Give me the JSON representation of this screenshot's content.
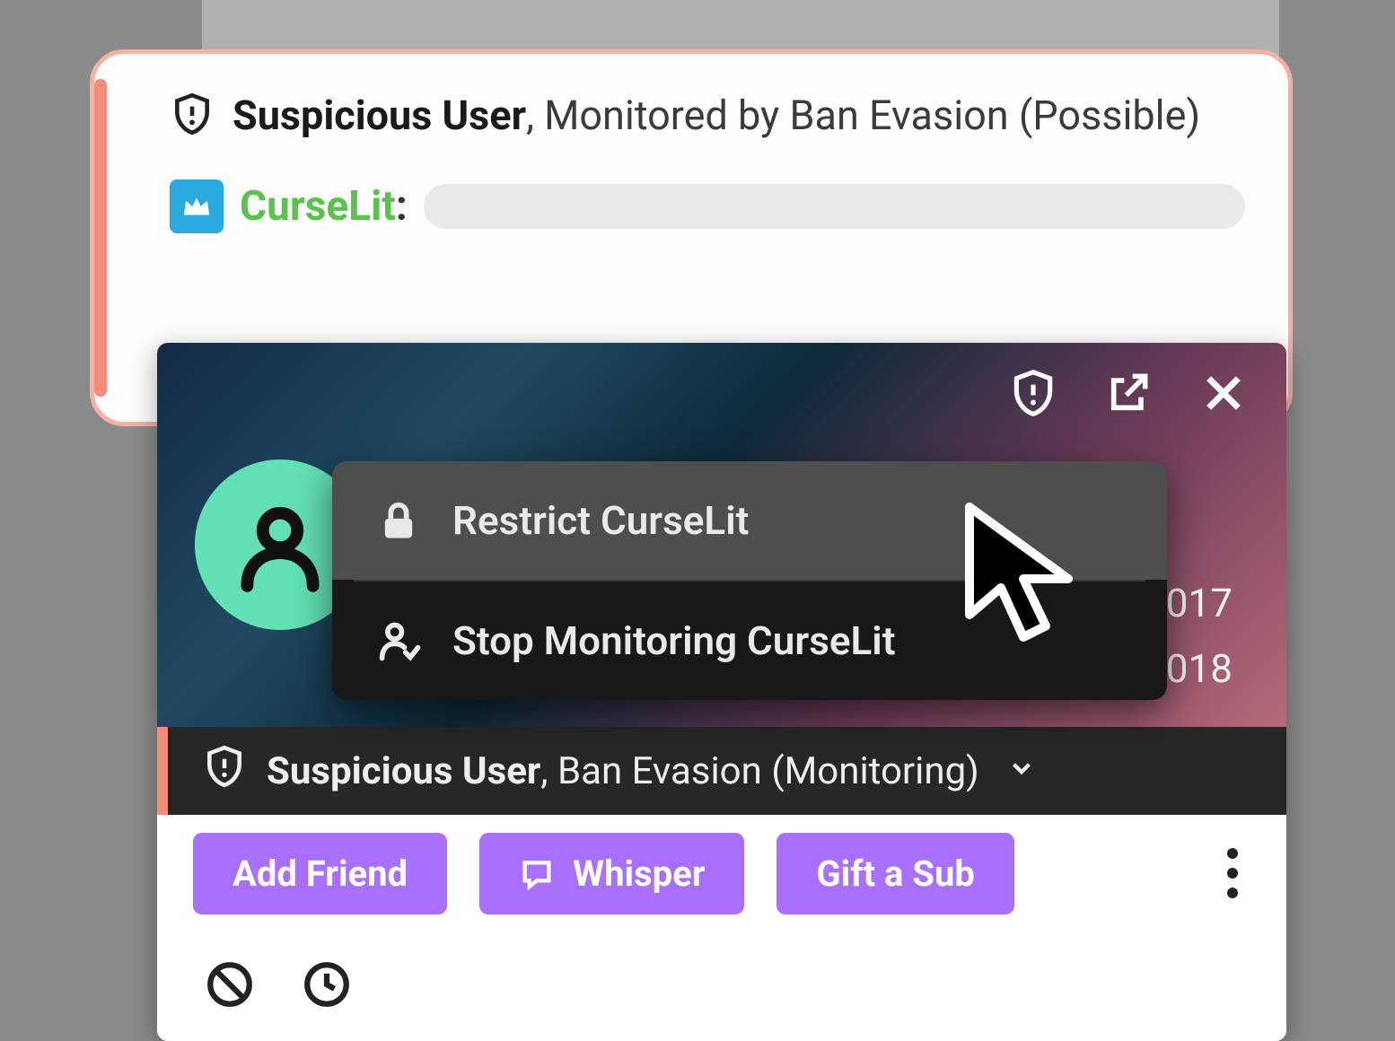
{
  "message": {
    "suspicious_label": "Suspicious User",
    "monitored_text": ", Monitored by Ban Evasion (Possible)",
    "username": "CurseLit",
    "badge": "crown-badge"
  },
  "card": {
    "years": {
      "a": "2017",
      "b": "2018"
    },
    "menu": {
      "restrict": "Restrict CurseLit",
      "stop": "Stop Monitoring CurseLit"
    },
    "status": {
      "label": "Suspicious User",
      "detail": ", Ban Evasion (Monitoring)"
    },
    "actions": {
      "add_friend": "Add Friend",
      "whisper": "Whisper",
      "gift": "Gift a Sub"
    }
  },
  "colors": {
    "accent": "#f28b7a",
    "purple": "#a970ff",
    "green_user": "#5cc24e",
    "avatar_bg": "#63e0b4"
  }
}
